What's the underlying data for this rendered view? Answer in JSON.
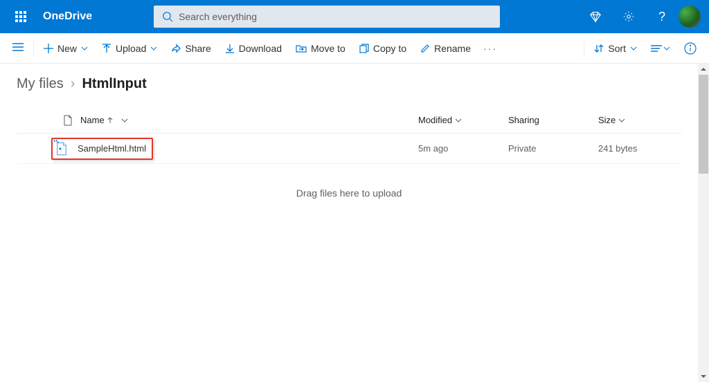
{
  "header": {
    "brand": "OneDrive",
    "search_placeholder": "Search everything"
  },
  "toolbar": {
    "new": "New",
    "upload": "Upload",
    "share": "Share",
    "download": "Download",
    "move_to": "Move to",
    "copy_to": "Copy to",
    "rename": "Rename",
    "sort": "Sort"
  },
  "breadcrumb": {
    "root": "My files",
    "current": "HtmlInput"
  },
  "columns": {
    "name": "Name",
    "modified": "Modified",
    "sharing": "Sharing",
    "size": "Size"
  },
  "rows": [
    {
      "name": "SampleHtml.html",
      "modified": "5m ago",
      "sharing": "Private",
      "size": "241 bytes"
    }
  ],
  "hints": {
    "drag": "Drag files here to upload"
  }
}
